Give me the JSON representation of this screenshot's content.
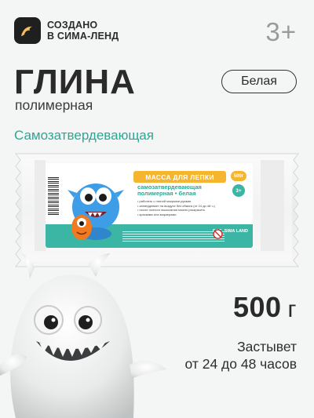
{
  "brand": {
    "line1": "СОЗДАНО",
    "line2": "В СИМА-ЛЕНД",
    "logo_icon": "bird-logo-icon"
  },
  "age_rating": "3+",
  "product": {
    "title": "ГЛИНА",
    "subtitle": "полимерная",
    "color": "Белая",
    "tagline": "Самозатвердевающая"
  },
  "package_label": {
    "banner": "МАССА ДЛЯ ЛЕПКИ",
    "weight": "500г",
    "age": "3+",
    "type_line1": "самозатвердевающая",
    "type_line2": "полимерная • белая",
    "bullets": [
      "работать с глиной мокрыми руками",
      "затвердевает на воздухе без обжига (от 24 до 48 ч.)",
      "после полного высыхания можно раскрасить",
      "красками или маркерами"
    ],
    "marks": [
      "EAC",
      "SIMA LAND"
    ]
  },
  "weight": {
    "value": "500",
    "unit": "г"
  },
  "hardening": {
    "line1": "Застывет",
    "line2": "от 24 до 48 часов"
  },
  "colors": {
    "accent": "#2aa893",
    "label_teal": "#3bb5a4",
    "banner_orange": "#f5b52e",
    "text_dark": "#2a2a2a",
    "age_gray": "#9a9a9a"
  }
}
